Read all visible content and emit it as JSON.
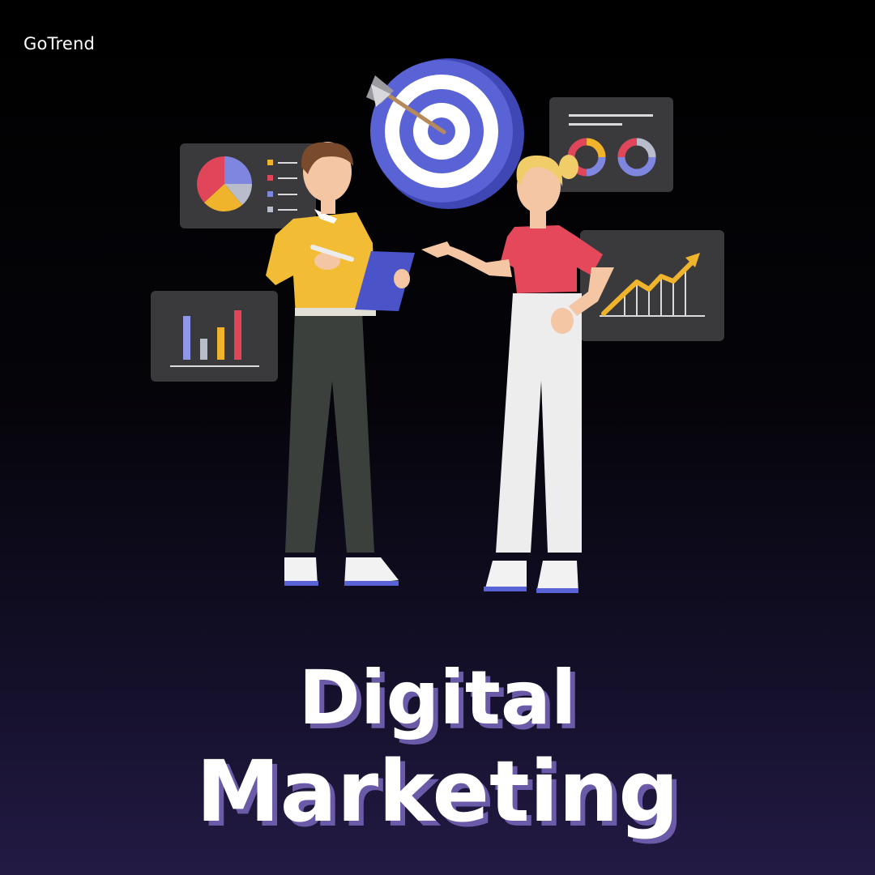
{
  "brand": {
    "name": "GoTrend"
  },
  "headline": {
    "line1": "Digital",
    "line2": "Marketing"
  },
  "illustration": {
    "icons": [
      "pie-chart-icon",
      "bar-chart-icon",
      "target-icon",
      "donut-chart-icon",
      "growth-line-chart-icon",
      "clipboard-icon",
      "pen-icon"
    ]
  },
  "colors": {
    "background_top": "#000000",
    "background_bottom": "#231a44",
    "panel": "#3a3a3c",
    "accent_blue": "#5a63d6",
    "accent_red": "#e0455a",
    "accent_yellow": "#f0b42c",
    "accent_grey": "#b8bccb",
    "title_shadow": "#6b5aa8"
  }
}
